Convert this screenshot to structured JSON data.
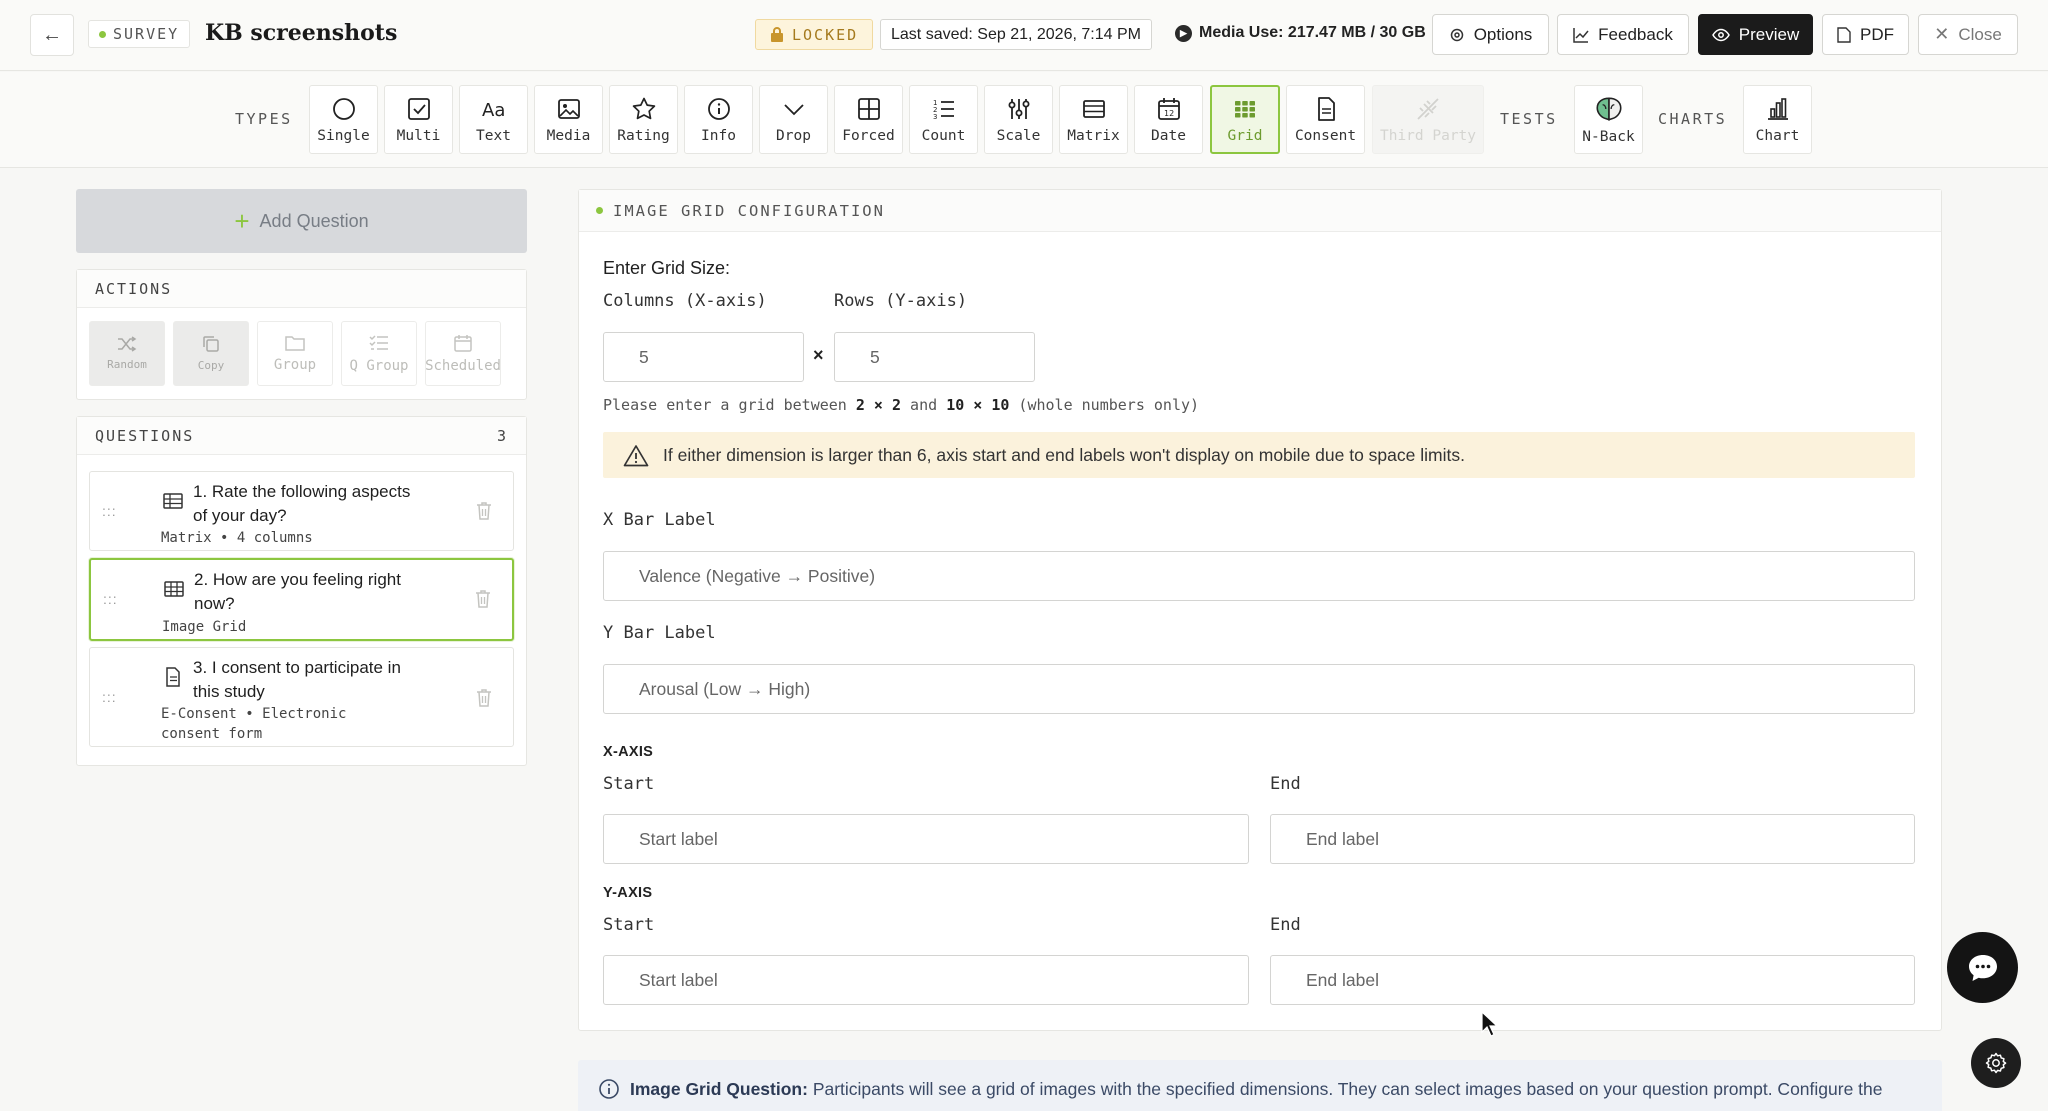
{
  "header": {
    "survey_tag": "SURVEY",
    "title": "KB screenshots",
    "locked": "LOCKED",
    "last_saved": "Last saved: Sep 21, 2026, 7:14 PM",
    "media_use": "Media Use: 217.47 MB / 30 GB",
    "buttons": {
      "options": "Options",
      "feedback": "Feedback",
      "preview": "Preview",
      "pdf": "PDF",
      "close": "Close"
    }
  },
  "types_bar": {
    "types_label": "TYPES",
    "tests_label": "TESTS",
    "charts_label": "CHARTS",
    "types": [
      "Single",
      "Multi",
      "Text",
      "Media",
      "Rating",
      "Info",
      "Drop",
      "Forced",
      "Count",
      "Scale",
      "Matrix",
      "Date",
      "Grid",
      "Consent",
      "Third Party"
    ],
    "active_type": "Grid",
    "tests": [
      "N-Back"
    ],
    "charts": [
      "Chart"
    ]
  },
  "sidebar": {
    "add_question": "Add Question",
    "actions_title": "ACTIONS",
    "actions": [
      "Random",
      "Copy",
      "Group",
      "Q Group",
      "Scheduled"
    ],
    "questions_title": "QUESTIONS",
    "question_count": "3",
    "questions": [
      {
        "title": "1. Rate the following aspects of your day?",
        "subtitle": "Matrix • 4 columns"
      },
      {
        "title": "2. How are you feeling right now?",
        "subtitle": "Image Grid"
      },
      {
        "title": "3. I consent to participate in this study",
        "subtitle": "E-Consent • Electronic consent form"
      }
    ]
  },
  "config": {
    "section_title": "IMAGE GRID CONFIGURATION",
    "grid_size_label": "Enter Grid Size:",
    "columns_label": "Columns (X-axis)",
    "rows_label": "Rows (Y-axis)",
    "columns_value": "5",
    "rows_value": "5",
    "times_symbol": "×",
    "hint_prefix": "Please enter a grid between ",
    "hint_min": "2 × 2",
    "hint_and": " and ",
    "hint_max": "10 × 10",
    "hint_suffix": " (whole numbers only)",
    "warning": "If either dimension is larger than 6, axis start and end labels won't display on mobile due to space limits.",
    "x_bar_label": "X Bar Label",
    "x_bar_value": "Valence (Negative → Positive)",
    "y_bar_label": "Y Bar Label",
    "y_bar_value": "Arousal (Low → High)",
    "x_axis_title": "X-AXIS",
    "y_axis_title": "Y-AXIS",
    "start_label": "Start",
    "end_label": "End",
    "start_placeholder": "Start label",
    "end_placeholder": "End label"
  },
  "info_strip": {
    "bold": "Image Grid Question:",
    "text": " Participants will see a grid of images with the specified dimensions. They can select images based on your question prompt. Configure the"
  },
  "colors": {
    "accent": "#8cc63f",
    "dark": "#1b1b1b",
    "warn_bg": "#fbf2dc"
  }
}
